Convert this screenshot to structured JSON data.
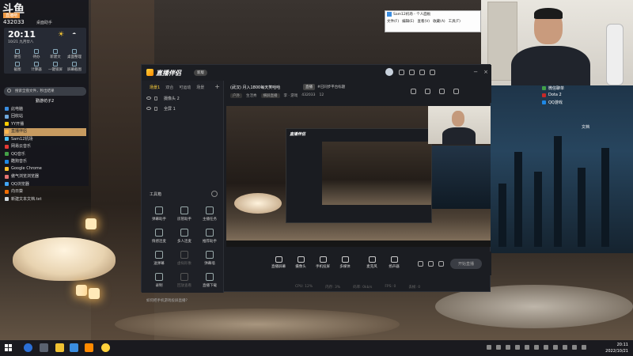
{
  "widget": {
    "logo": "斗鱼",
    "logo_sub": "直播吧",
    "room_number": "432033",
    "title": "桌面助手",
    "time": "20:11",
    "date": "10/21 九月廿八",
    "tools": [
      "便签",
      "待办",
      "新建文",
      "桌面整理",
      "截图",
      "计算器",
      "一键锁屏",
      "屏幕截图"
    ],
    "search_placeholder": "搜索全盘文件，秒出结果",
    "list_header": "勤游坊子2",
    "list": [
      {
        "label": "此电脑",
        "color": "#3a8de0"
      },
      {
        "label": "回收站",
        "color": "#6fa8dc"
      },
      {
        "label": "YY开播",
        "color": "#ffcc00"
      },
      {
        "label": "直播伴侣",
        "color": "#ffb74d",
        "selected": true
      },
      {
        "label": "Sam12机场",
        "color": "#4fc3f7"
      },
      {
        "label": "网易云音乐",
        "color": "#e53935"
      },
      {
        "label": "QQ音乐",
        "color": "#43a047"
      },
      {
        "label": "酷狗音乐",
        "color": "#1e88e5"
      },
      {
        "label": "Google Chrome",
        "color": "#fbc02d"
      },
      {
        "label": "傲气浏览浏览器",
        "color": "#e57373"
      },
      {
        "label": "QQ浏览器",
        "color": "#42a5f5"
      },
      {
        "label": "向日葵",
        "color": "#ef6c00"
      },
      {
        "label": "新建文本文档.txt",
        "color": "#cfd8dc"
      }
    ]
  },
  "browser_window": {
    "title": "Sam12机场 - 个人面板",
    "menu": [
      "文件(F)",
      "编辑(E)",
      "查看(V)",
      "收藏(A)",
      "工具(T)"
    ]
  },
  "right_desktop": [
    {
      "label": "微信聊单",
      "color": "#43a047"
    },
    {
      "label": "Dota 2",
      "color": "#c62828"
    },
    {
      "label": "QQ游戏",
      "color": "#1e88e5"
    }
  ],
  "right_label": "文档",
  "app": {
    "name": "直播伴侣",
    "version": "新版",
    "source_tabs": [
      "场景1",
      "双合",
      "可运动",
      "场景"
    ],
    "sources": [
      "摄像头 2",
      "全屏 1"
    ],
    "tools_title": "工具箱",
    "tools": [
      {
        "label": "弹幕助手"
      },
      {
        "label": "房管助手"
      },
      {
        "label": "主播任务"
      },
      {
        "label": "情感连麦"
      },
      {
        "label": "多人连麦"
      },
      {
        "label": "推荐助手"
      },
      {
        "label": "送弹幕"
      },
      {
        "label": "虚拟形象",
        "dim": true
      },
      {
        "label": "弹幕墙"
      },
      {
        "label": "录制"
      },
      {
        "label": "回放查看",
        "dim": true
      },
      {
        "label": "直播下载"
      }
    ],
    "tip": "如何把手机游戏投屏直播？",
    "room": {
      "title": "(武汉) 月入1800每天笑哈哈",
      "tag": "直播",
      "note": "#已同步平台标题",
      "meta": [
        "户外",
        "生活秀",
        "横屏直播",
        "李 · 游戏",
        "432033"
      ],
      "likes": "12"
    },
    "controls": [
      "直播屏幕",
      "摄像头",
      "手机投屏",
      "多媒体",
      "麦克风",
      "扬声器"
    ],
    "go_live": "开始直播",
    "status": [
      "CPU: 12%",
      "内存: 3%",
      "码率: 0kb/s",
      "FPS: 0",
      "丢帧: 0"
    ]
  },
  "taskbar": {
    "time": "20:11",
    "date": "2022/10/21"
  }
}
